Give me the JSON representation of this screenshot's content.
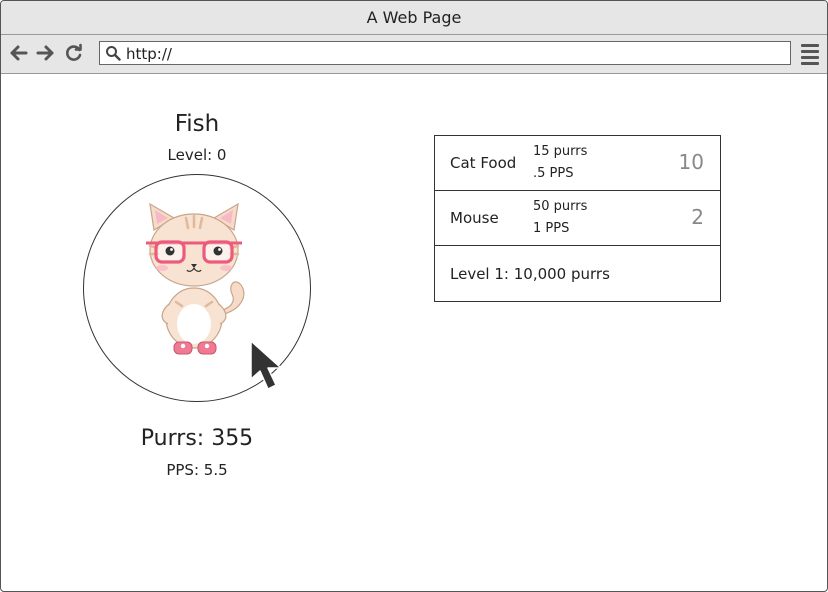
{
  "window": {
    "title": "A Web Page"
  },
  "toolbar": {
    "url": "http://"
  },
  "player": {
    "name": "Fish",
    "level": "Level: 0",
    "purrs": "Purrs: 355",
    "pps": "PPS: 5.5"
  },
  "shop": {
    "items": [
      {
        "label": "Cat Food",
        "cost": "15 purrs",
        "rate": ".5 PPS",
        "count": "10"
      },
      {
        "label": "Mouse",
        "cost": "50 purrs",
        "rate": "1 PPS",
        "count": "2"
      }
    ],
    "level_upgrade": "Level 1: 10,000 purrs"
  },
  "icons": [
    "back-arrow-icon",
    "forward-arrow-icon",
    "reload-icon",
    "search-icon",
    "menu-icon",
    "cat-image",
    "mouse-cursor-icon"
  ]
}
